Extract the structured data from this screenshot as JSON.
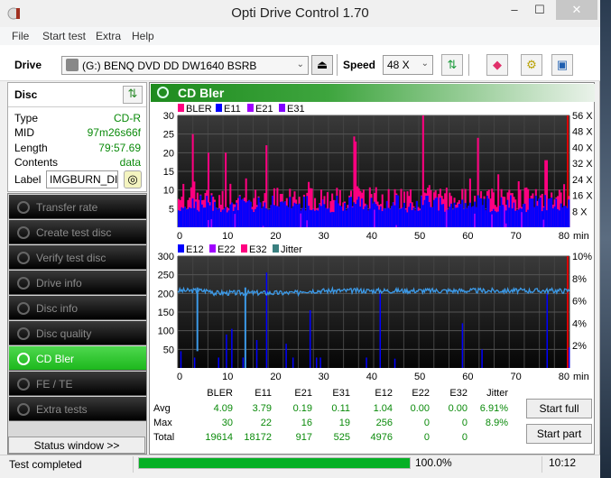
{
  "window": {
    "title": "Opti Drive Control 1.70",
    "minimize": "–",
    "maximize": "☐",
    "close": "✕"
  },
  "menu": [
    "File",
    "Start test",
    "Extra",
    "Help"
  ],
  "toolbar": {
    "drive_label": "Drive",
    "drive_value": "(G:)   BENQ DVD DD DW1640 BSRB",
    "speed_label": "Speed",
    "speed_value": "48 X"
  },
  "disc": {
    "title": "Disc",
    "rows": [
      {
        "k": "Type",
        "v": "CD-R"
      },
      {
        "k": "MID",
        "v": "97m26s66f"
      },
      {
        "k": "Length",
        "v": "79:57.69"
      },
      {
        "k": "Contents",
        "v": "data"
      }
    ],
    "label_key": "Label",
    "label_value": "IMGBURN_DIS"
  },
  "nav": [
    {
      "label": "Transfer rate"
    },
    {
      "label": "Create test disc"
    },
    {
      "label": "Verify test disc"
    },
    {
      "label": "Drive info"
    },
    {
      "label": "Disc info"
    },
    {
      "label": "Disc quality"
    },
    {
      "label": "CD Bler",
      "active": true
    },
    {
      "label": "FE / TE"
    },
    {
      "label": "Extra tests"
    }
  ],
  "status_window_btn": "Status window >>",
  "main_title": "CD Bler",
  "chart_data": [
    {
      "type": "bar",
      "title": "",
      "legend": [
        {
          "name": "BLER",
          "color": "#ff0080"
        },
        {
          "name": "E11",
          "color": "#0000ff"
        },
        {
          "name": "E21",
          "color": "#a000ff"
        },
        {
          "name": "E31",
          "color": "#8000ff"
        }
      ],
      "xlabel": "min",
      "xlim": [
        0,
        80
      ],
      "x_ticks": [
        "0",
        "10",
        "20",
        "30",
        "40",
        "50",
        "60",
        "70",
        "80"
      ],
      "ylim": [
        0,
        30
      ],
      "y_ticks": [
        "5",
        "10",
        "15",
        "20",
        "25",
        "30"
      ],
      "y2_ticks": [
        "8 X",
        "16 X",
        "24 X",
        "32 X",
        "40 X",
        "48 X",
        "56 X"
      ],
      "peaks": [
        {
          "x": 3,
          "BLER": 25
        },
        {
          "x": 6,
          "BLER": 20
        },
        {
          "x": 9.5,
          "BLER": 20
        },
        {
          "x": 18,
          "BLER": 22
        },
        {
          "x": 36,
          "BLER": 23
        },
        {
          "x": 50,
          "BLER": 30
        },
        {
          "x": 61,
          "BLER": 24
        },
        {
          "x": 75,
          "BLER": 18
        }
      ],
      "baseline": {
        "BLER": 9,
        "E11": 8
      }
    },
    {
      "type": "bar",
      "title": "",
      "legend": [
        {
          "name": "E12",
          "color": "#0000ff"
        },
        {
          "name": "E22",
          "color": "#a000ff"
        },
        {
          "name": "E32",
          "color": "#ff0080"
        },
        {
          "name": "Jitter",
          "color": "#3a8080"
        }
      ],
      "xlabel": "min",
      "xlim": [
        0,
        80
      ],
      "x_ticks": [
        "0",
        "10",
        "20",
        "30",
        "40",
        "50",
        "60",
        "70",
        "80"
      ],
      "ylim": [
        0,
        300
      ],
      "y_ticks": [
        "50",
        "100",
        "150",
        "200",
        "250",
        "300"
      ],
      "y2_ticks": [
        "2%",
        "4%",
        "6%",
        "8%",
        "10%"
      ],
      "E12_spikes": [
        {
          "x": 0.5,
          "v": 45
        },
        {
          "x": 3.3,
          "v": 28
        },
        {
          "x": 8.2,
          "v": 28
        },
        {
          "x": 9.8,
          "v": 90
        },
        {
          "x": 10.9,
          "v": 105
        },
        {
          "x": 13.2,
          "v": 28
        },
        {
          "x": 16,
          "v": 75
        },
        {
          "x": 18,
          "v": 256
        },
        {
          "x": 22,
          "v": 65
        },
        {
          "x": 23.4,
          "v": 28
        },
        {
          "x": 26.9,
          "v": 155
        },
        {
          "x": 28.2,
          "v": 28
        },
        {
          "x": 29,
          "v": 28
        },
        {
          "x": 38.4,
          "v": 28
        },
        {
          "x": 41.2,
          "v": 200
        },
        {
          "x": 44.2,
          "v": 25
        },
        {
          "x": 58,
          "v": 120
        },
        {
          "x": 62,
          "v": 50
        },
        {
          "x": 75.3,
          "v": 200
        },
        {
          "x": 79.8,
          "v": 55
        }
      ],
      "jitter_avg_percent": 6.91
    }
  ],
  "stats": {
    "headers": [
      "BLER",
      "E11",
      "E21",
      "E31",
      "E12",
      "E22",
      "E32",
      "Jitter"
    ],
    "rows": [
      {
        "label": "Avg",
        "values": [
          "4.09",
          "3.79",
          "0.19",
          "0.11",
          "1.04",
          "0.00",
          "0.00",
          "6.91%"
        ]
      },
      {
        "label": "Max",
        "values": [
          "30",
          "22",
          "16",
          "19",
          "256",
          "0",
          "0",
          "8.9%"
        ]
      },
      {
        "label": "Total",
        "values": [
          "19614",
          "18172",
          "917",
          "525",
          "4976",
          "0",
          "0",
          ""
        ]
      }
    ]
  },
  "buttons": {
    "start_full": "Start full",
    "start_part": "Start part"
  },
  "statusbar": {
    "text": "Test completed",
    "progress_percent": 100,
    "progress_label": "100.0%",
    "time": "10:12"
  }
}
